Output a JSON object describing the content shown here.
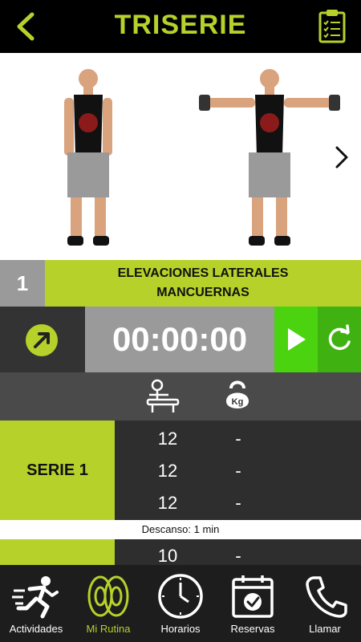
{
  "header": {
    "title": "TRISERIE"
  },
  "exercise": {
    "number": "1",
    "name": "ELEVACIONES LATERALES MANCUERNAS"
  },
  "timer": {
    "value": "00:00:00"
  },
  "series": [
    {
      "label": "SERIE 1",
      "reps": [
        {
          "reps": "12",
          "kg": "-"
        },
        {
          "reps": "12",
          "kg": "-"
        },
        {
          "reps": "12",
          "kg": "-"
        }
      ]
    },
    {
      "label": "",
      "reps": [
        {
          "reps": "10",
          "kg": "-"
        }
      ]
    }
  ],
  "rest": {
    "text": "Descanso: 1 min"
  },
  "nav": {
    "items": [
      {
        "label": "Actividades",
        "icon": "runner-icon"
      },
      {
        "label": "Mi Rutina",
        "icon": "weight-plates-icon",
        "active": true
      },
      {
        "label": "Horarios",
        "icon": "clock-icon"
      },
      {
        "label": "Reservas",
        "icon": "calendar-check-icon"
      },
      {
        "label": "Llamar",
        "icon": "phone-icon"
      }
    ]
  },
  "colors": {
    "accent": "#b6d12a",
    "play": "#4bd30f",
    "reset": "#3fb212",
    "dark": "#2e2e2e"
  }
}
